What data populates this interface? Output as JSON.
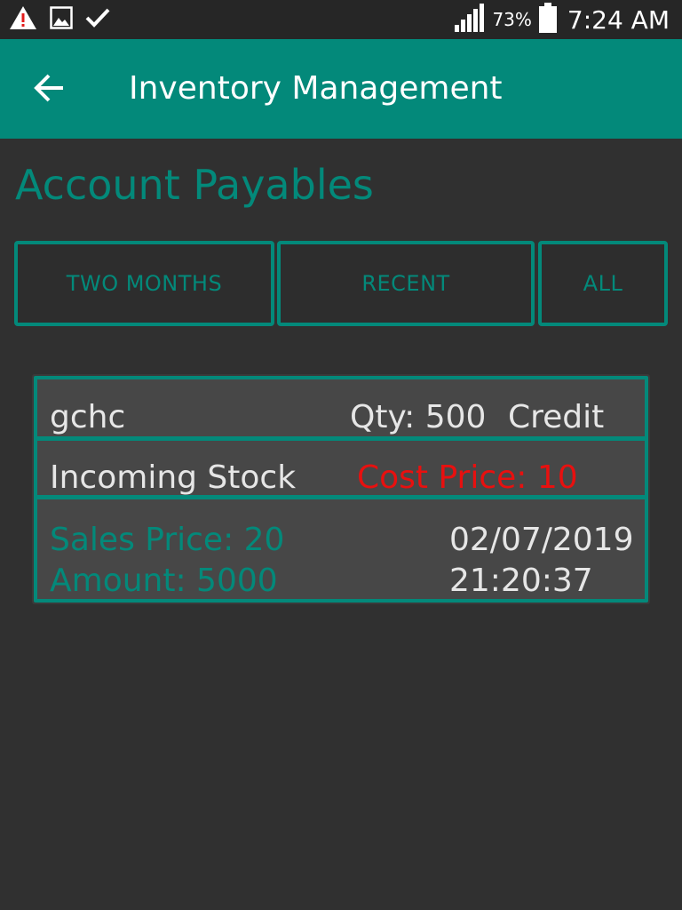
{
  "status_bar": {
    "icons": [
      "warning-icon",
      "image-icon",
      "check-icon"
    ],
    "signal": "signal-icon",
    "battery_percent": "73%",
    "battery": "battery-icon",
    "time": "7:24 AM"
  },
  "app_bar": {
    "back_icon": "arrow-back-icon",
    "title": "Inventory Management",
    "color": "#03897a"
  },
  "page": {
    "title": "Account Payables"
  },
  "filters": [
    {
      "label": "TWO MONTHS"
    },
    {
      "label": "RECENT"
    },
    {
      "label": "ALL"
    }
  ],
  "records": [
    {
      "name": "gchc",
      "qty": "Qty: 500",
      "payment": "Credit",
      "type": "Incoming Stock",
      "cost_price": "Cost Price: 10",
      "sales_price": "Sales Price: 20",
      "amount": "Amount: 5000",
      "date": "02/07/2019",
      "time": "21:20:37"
    }
  ],
  "colors": {
    "accent": "#03897a",
    "background": "#303030",
    "cost_price": "#e8100f"
  }
}
